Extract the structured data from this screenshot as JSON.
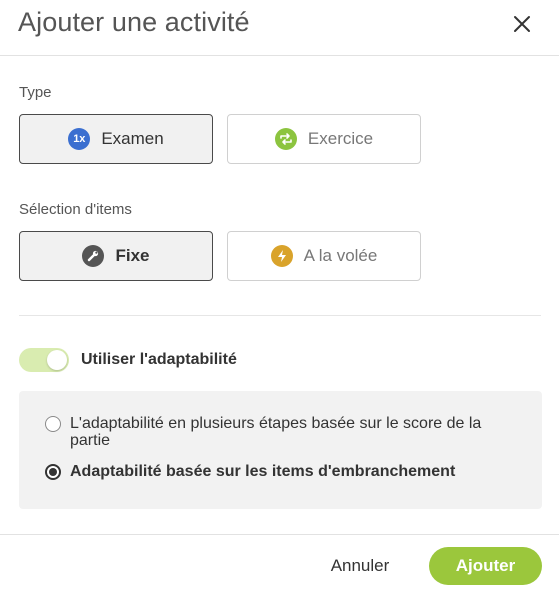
{
  "dialog": {
    "title": "Ajouter une activité",
    "close_icon": "close-icon"
  },
  "type_section": {
    "label": "Type",
    "options": [
      {
        "label": "Examen",
        "icon": "1x-badge-icon",
        "icon_text": "1x",
        "icon_color": "#3b6fd0",
        "selected": true
      },
      {
        "label": "Exercice",
        "icon": "repeat-icon",
        "icon_color": "#8cc43f",
        "selected": false
      }
    ]
  },
  "items_section": {
    "label": "Sélection d'items",
    "options": [
      {
        "label": "Fixe",
        "icon": "wrench-icon",
        "icon_color": "#555555",
        "selected": true
      },
      {
        "label": "A la volée",
        "icon": "lightning-icon",
        "icon_color": "#d9a32b",
        "selected": false
      }
    ]
  },
  "adaptability": {
    "toggle_label": "Utiliser l'adaptabilité",
    "enabled": true,
    "options": [
      {
        "label": "L'adaptabilité en plusieurs étapes basée sur le score de la partie",
        "checked": false
      },
      {
        "label": "Adaptabilité basée sur les items d'embranchement",
        "checked": true
      }
    ]
  },
  "footer": {
    "cancel_label": "Annuler",
    "submit_label": "Ajouter"
  },
  "colors": {
    "accent": "#9bc73c",
    "toggle_track": "#d9ecb0"
  }
}
